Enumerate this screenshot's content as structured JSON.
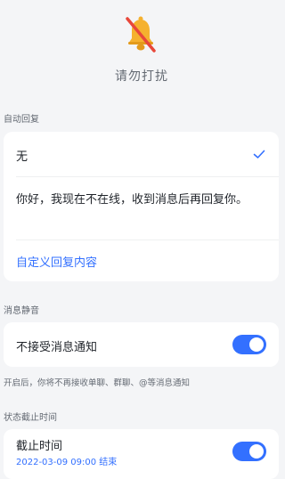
{
  "header": {
    "title": "请勿打扰"
  },
  "auto_reply": {
    "section_label": "自动回复",
    "options": [
      {
        "label": "无",
        "selected": true
      },
      {
        "label": "你好，我现在不在线，收到消息后再回复你。",
        "selected": false
      }
    ],
    "custom_label": "自定义回复内容"
  },
  "mute": {
    "section_label": "消息静音",
    "label": "不接受消息通知",
    "enabled": true,
    "hint": "开启后，你将不再接收单聊、群聊、@等消息通知"
  },
  "status_end": {
    "section_label": "状态截止时间",
    "label": "截止时间",
    "value": "2022-03-09 09:00 结束",
    "enabled": true
  },
  "colors": {
    "accent": "#3370FF",
    "background": "#F4F5F7",
    "bell": "#F5B12E",
    "slash": "#E8473A"
  },
  "icons": {
    "bell": "bell-muted-icon",
    "check": "check-icon"
  }
}
